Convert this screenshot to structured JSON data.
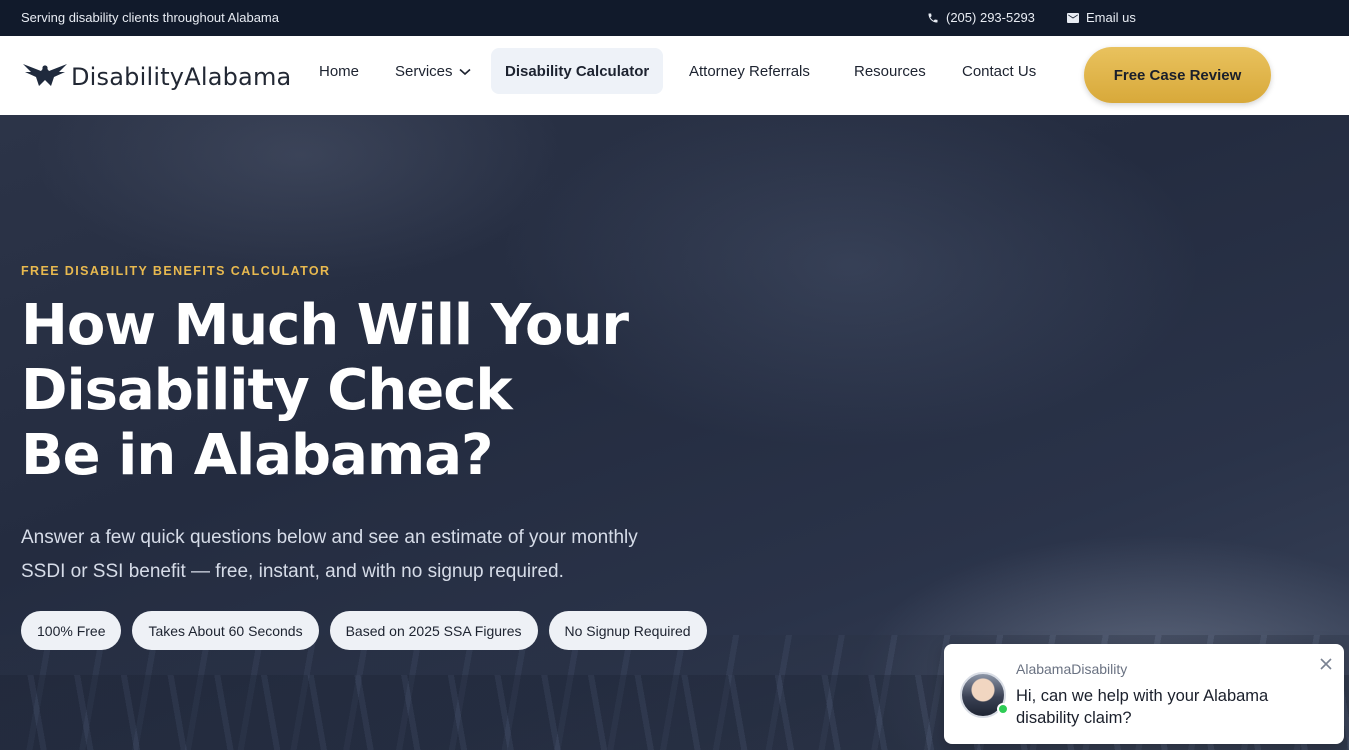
{
  "topbar": {
    "tagline": "Serving disability clients throughout Alabama",
    "phone": "(205) 293-5293",
    "email_label": "Email us",
    "phone_icon": "phone-icon",
    "email_icon": "envelope-icon"
  },
  "header": {
    "logo_text": "DisabilityAlabama",
    "logo_icon": "eagle-icon",
    "nav": {
      "home": "Home",
      "services": "Services",
      "calculator": "Disability Calculator",
      "referrals": "Attorney Referrals",
      "resources": "Resources",
      "contact": "Contact Us"
    },
    "active_item": "Disability Calculator",
    "cta_label": "Free Case Review"
  },
  "hero": {
    "eyebrow": "FREE DISABILITY BENEFITS CALCULATOR",
    "headline_lines": [
      "How Much Will Your",
      "Disability Check",
      "Be in Alabama?"
    ],
    "subtext_lines": [
      "Answer a few quick questions below and see an estimate of your monthly",
      "SSDI or SSI benefit — free, instant, and with no signup required."
    ],
    "pills": [
      "100% Free",
      "Takes About 60 Seconds",
      "Based on 2025 SSA Figures",
      "No Signup Required"
    ]
  },
  "chat": {
    "sender": "AlabamaDisability",
    "message": "Hi, can we help with your Alabama disability claim?",
    "status": "online",
    "close_icon": "close-icon"
  },
  "colors": {
    "topbar_bg": "#111a2b",
    "accent_gold": "#e1b54b",
    "hero_bg": "#2a3247",
    "online_green": "#2ecc55"
  }
}
